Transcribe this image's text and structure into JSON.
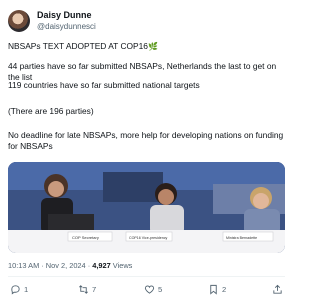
{
  "tweet": {
    "author_name": "Daisy Dunne",
    "author_handle": "@daisydunnesci",
    "line1": "NBSAPs TEXT ADOPTED AT COP16",
    "line1_emoji": "🌿",
    "line2": "44 parties have so far submitted NBSAPs, Netherlands the last to get on the list",
    "line3": "119 countries have so far submitted national targets",
    "line4": "(There are 196 parties)",
    "line5": "No deadline for late NBSAPs, more help for developing nations on funding for NBSAPs",
    "timestamp": "10:13 AM · Nov 2, 2024 · ",
    "views_count": "4,927",
    "views_label": " Views"
  },
  "photo": {
    "nameplates": [
      "COP Secretary",
      "COP16 Vice-presidency",
      "Ministra Bernadette"
    ]
  },
  "actions": {
    "reply_count": "1",
    "retweet_count": "7",
    "like_count": "5",
    "bookmark_count": "2"
  },
  "colors": {
    "text": "#0f1419",
    "secondary": "#536471",
    "photo_backdrop": "#3a4e78"
  }
}
